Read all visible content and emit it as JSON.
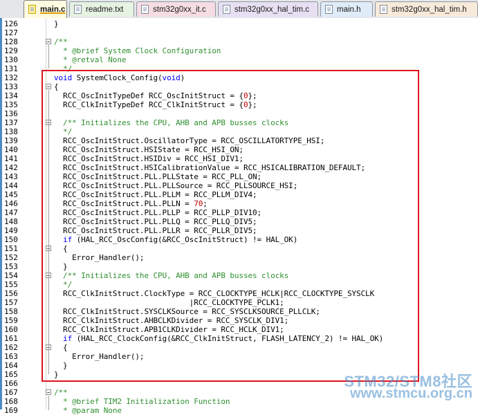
{
  "tabs": [
    {
      "label": "main.c",
      "active": true,
      "color": "#fffbe0"
    },
    {
      "label": "readme.txt",
      "active": false,
      "color": "#e6f2e2"
    },
    {
      "label": "stm32g0xx_it.c",
      "active": false,
      "color": "#f6dde3"
    },
    {
      "label": "stm32g0xx_hal_tim.c",
      "active": false,
      "color": "#e7e0f3"
    },
    {
      "label": "main.h",
      "active": false,
      "color": "#e0ecf8"
    },
    {
      "label": "stm32g0xx_hal_tim.h",
      "active": false,
      "color": "#f8eadb"
    }
  ],
  "editor": {
    "lines": [
      {
        "n": "126",
        "text": "}"
      },
      {
        "n": "127",
        "text": ""
      },
      {
        "n": "128",
        "text": "/**"
      },
      {
        "n": "129",
        "text": "  * @brief System Clock Configuration"
      },
      {
        "n": "130",
        "text": "  * @retval None"
      },
      {
        "n": "131",
        "text": "  */"
      },
      {
        "n": "132",
        "text": "void SystemClock_Config(void)"
      },
      {
        "n": "133",
        "text": "{"
      },
      {
        "n": "134",
        "text": "  RCC_OscInitTypeDef RCC_OscInitStruct = {0};"
      },
      {
        "n": "135",
        "text": "  RCC_ClkInitTypeDef RCC_ClkInitStruct = {0};"
      },
      {
        "n": "136",
        "text": ""
      },
      {
        "n": "137",
        "text": "  /** Initializes the CPU, AHB and APB busses clocks"
      },
      {
        "n": "138",
        "text": "  */"
      },
      {
        "n": "139",
        "text": "  RCC_OscInitStruct.OscillatorType = RCC_OSCILLATORTYPE_HSI;"
      },
      {
        "n": "140",
        "text": "  RCC_OscInitStruct.HSIState = RCC_HSI_ON;"
      },
      {
        "n": "141",
        "text": "  RCC_OscInitStruct.HSIDiv = RCC_HSI_DIV1;"
      },
      {
        "n": "142",
        "text": "  RCC_OscInitStruct.HSICalibrationValue = RCC_HSICALIBRATION_DEFAULT;"
      },
      {
        "n": "143",
        "text": "  RCC_OscInitStruct.PLL.PLLState = RCC_PLL_ON;"
      },
      {
        "n": "144",
        "text": "  RCC_OscInitStruct.PLL.PLLSource = RCC_PLLSOURCE_HSI;"
      },
      {
        "n": "145",
        "text": "  RCC_OscInitStruct.PLL.PLLM = RCC_PLLM_DIV4;"
      },
      {
        "n": "146",
        "text": "  RCC_OscInitStruct.PLL.PLLN = 70;"
      },
      {
        "n": "147",
        "text": "  RCC_OscInitStruct.PLL.PLLP = RCC_PLLP_DIV10;"
      },
      {
        "n": "148",
        "text": "  RCC_OscInitStruct.PLL.PLLQ = RCC_PLLQ_DIV5;"
      },
      {
        "n": "149",
        "text": "  RCC_OscInitStruct.PLL.PLLR = RCC_PLLR_DIV5;"
      },
      {
        "n": "150",
        "text": "  if (HAL_RCC_OscConfig(&RCC_OscInitStruct) != HAL_OK)"
      },
      {
        "n": "151",
        "text": "  {"
      },
      {
        "n": "152",
        "text": "    Error_Handler();"
      },
      {
        "n": "153",
        "text": "  }"
      },
      {
        "n": "154",
        "text": "  /** Initializes the CPU, AHB and APB busses clocks"
      },
      {
        "n": "155",
        "text": "  */"
      },
      {
        "n": "156",
        "text": "  RCC_ClkInitStruct.ClockType = RCC_CLOCKTYPE_HCLK|RCC_CLOCKTYPE_SYSCLK"
      },
      {
        "n": "157",
        "text": "                              |RCC_CLOCKTYPE_PCLK1;"
      },
      {
        "n": "158",
        "text": "  RCC_ClkInitStruct.SYSCLKSource = RCC_SYSCLKSOURCE_PLLCLK;"
      },
      {
        "n": "159",
        "text": "  RCC_ClkInitStruct.AHBCLKDivider = RCC_SYSCLK_DIV1;"
      },
      {
        "n": "160",
        "text": "  RCC_ClkInitStruct.APB1CLKDivider = RCC_HCLK_DIV1;"
      },
      {
        "n": "161",
        "text": "  if (HAL_RCC_ClockConfig(&RCC_ClkInitStruct, FLASH_LATENCY_2) != HAL_OK)"
      },
      {
        "n": "162",
        "text": "  {"
      },
      {
        "n": "163",
        "text": "    Error_Handler();"
      },
      {
        "n": "164",
        "text": "  }"
      },
      {
        "n": "165",
        "text": "}"
      },
      {
        "n": "166",
        "text": ""
      },
      {
        "n": "167",
        "text": "/**"
      },
      {
        "n": "168",
        "text": "  * @brief TIM2 Initialization Function"
      },
      {
        "n": "169",
        "text": "  * @param None"
      }
    ]
  },
  "watermark": {
    "line1": "STM32/STM8社区",
    "line2": "www.stmcu.org.cn"
  },
  "colors": {
    "highlight_box": "#e0141e",
    "comment": "#2f8f2f",
    "keyword": "#0000ff",
    "number": "#c00000"
  }
}
